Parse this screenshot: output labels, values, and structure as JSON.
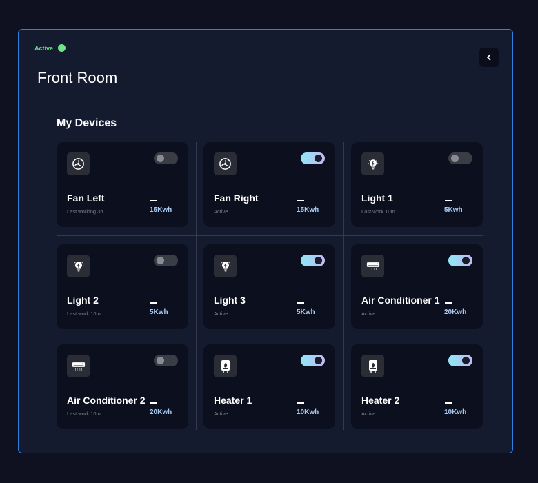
{
  "status": {
    "label": "Active",
    "color": "#6fe58a"
  },
  "room": {
    "title": "Front Room"
  },
  "section": {
    "title": "My Devices"
  },
  "colors": {
    "accent_border": "#2f7fe0",
    "energy": "#a9cbf3"
  },
  "devices": [
    {
      "name": "Fan Left",
      "sub": "Last working 3h",
      "energy": "15Kwh",
      "on": false,
      "icon": "fan-icon"
    },
    {
      "name": "Fan Right",
      "sub": "Active",
      "energy": "15Kwh",
      "on": true,
      "icon": "fan-icon"
    },
    {
      "name": "Light 1",
      "sub": "Last work 10m",
      "energy": "5Kwh",
      "on": false,
      "icon": "lightbulb-icon"
    },
    {
      "name": "Light 2",
      "sub": "Last work 10m",
      "energy": "5Kwh",
      "on": false,
      "icon": "lightbulb-icon"
    },
    {
      "name": "Light 3",
      "sub": "Active",
      "energy": "5Kwh",
      "on": true,
      "icon": "lightbulb-icon"
    },
    {
      "name": "Air Conditioner 1",
      "sub": "Active",
      "energy": "20Kwh",
      "on": true,
      "icon": "air-conditioner-icon"
    },
    {
      "name": "Air Conditioner 2",
      "sub": "Last work 10m",
      "energy": "20Kwh",
      "on": false,
      "icon": "air-conditioner-icon"
    },
    {
      "name": "Heater 1",
      "sub": "Active",
      "energy": "10Kwh",
      "on": true,
      "icon": "heater-icon"
    },
    {
      "name": "Heater 2",
      "sub": "Active",
      "energy": "10Kwh",
      "on": true,
      "icon": "heater-icon"
    }
  ]
}
